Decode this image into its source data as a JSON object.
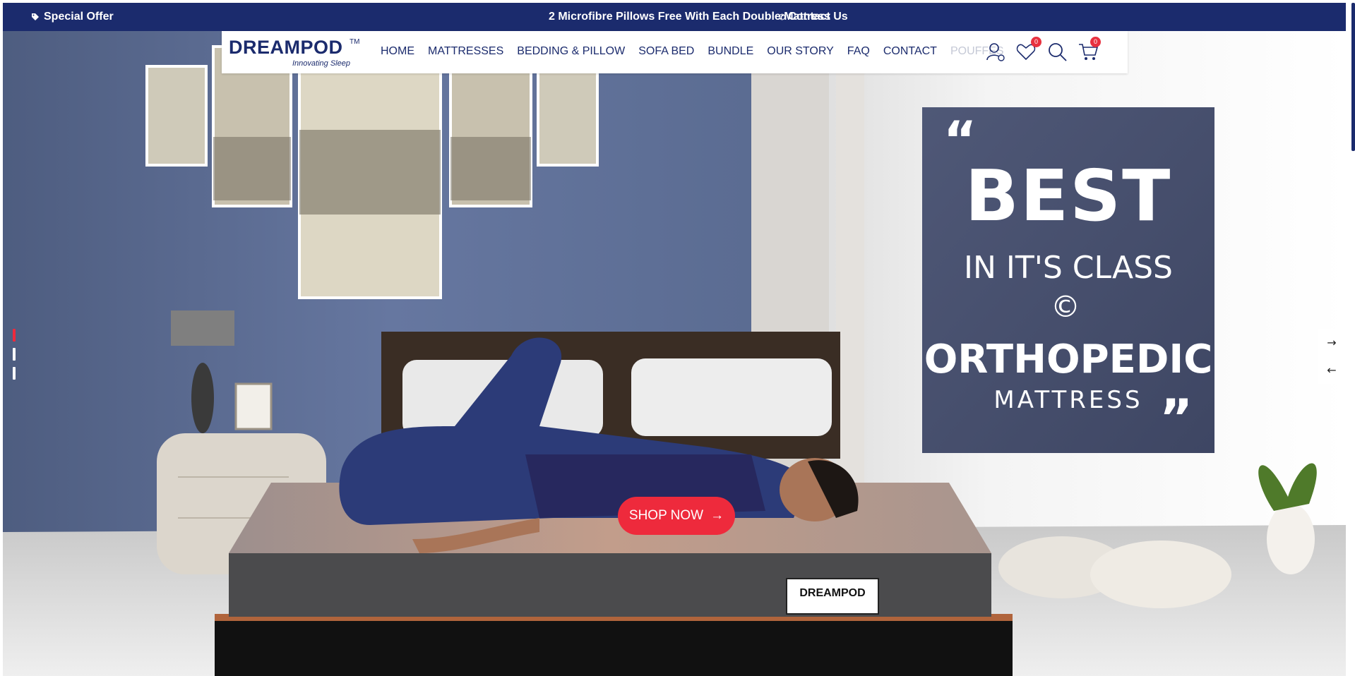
{
  "topbar": {
    "offer_label": "Special Offer",
    "promo_message": "2 Microfibre Pillows Free With Each Double Mattress",
    "contact_label": "Contact Us"
  },
  "brand": {
    "name": "DREAMPOD",
    "trademark": "TM",
    "tagline": "Innovating Sleep"
  },
  "nav": {
    "items": [
      {
        "label": "HOME"
      },
      {
        "label": "MATTRESSES"
      },
      {
        "label": "BEDDING & PILLOW"
      },
      {
        "label": "SOFA BED"
      },
      {
        "label": "BUNDLE"
      },
      {
        "label": "OUR STORY"
      },
      {
        "label": "FAQ"
      },
      {
        "label": "CONTACT"
      },
      {
        "label": "POUFFES"
      }
    ]
  },
  "header_icons": {
    "account": "user-icon",
    "wishlist": "heart-icon",
    "wishlist_count": "0",
    "search": "search-icon",
    "cart": "cart-icon",
    "cart_count": "0"
  },
  "hero": {
    "poster_line1": "BEST",
    "poster_line2": "IN IT'S CLASS",
    "poster_line3": "ORTHOPEDIC",
    "poster_line4": "MATTRESS",
    "mattress_label": "DREAMPOD",
    "cta_label": "SHOP NOW",
    "slides_total": 3,
    "active_slide": 1
  },
  "colors": {
    "navy": "#1b2b6d",
    "accent_red": "#ee2a3c",
    "wall_blue": "#5c6d91"
  }
}
